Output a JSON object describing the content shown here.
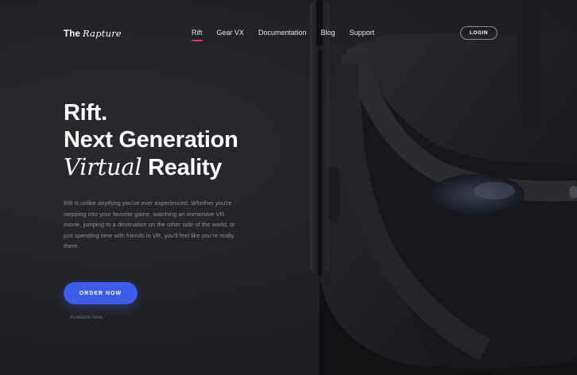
{
  "brand": {
    "name": "The",
    "name_italic": "Rapture"
  },
  "nav": {
    "items": [
      {
        "label": "Rift",
        "active": true
      },
      {
        "label": "Gear VX",
        "active": false
      },
      {
        "label": "Documentation",
        "active": false
      },
      {
        "label": "Blog",
        "active": false
      },
      {
        "label": "Support",
        "active": false
      }
    ],
    "login_label": "LOGIN"
  },
  "hero": {
    "line1": "Rift.",
    "line2": "Next Generation",
    "line3_italic": "Virtual",
    "line3_rest": "Reality",
    "description": "Rift is unlike anything you've ever experienced. Whether you're stepping into your favorite game, watching an immersive VR movie, jumping to a destination on the other side of the world, or just spending time with friends in VR, you'll feel like you're really there.",
    "order_label": "ORDER NOW",
    "availability": "Available Now."
  },
  "colors": {
    "background": "#212125",
    "accent_underline": "#e8365d",
    "button": "#3d5ce8"
  },
  "icons": {
    "hero_image": "vr-headset-image"
  }
}
